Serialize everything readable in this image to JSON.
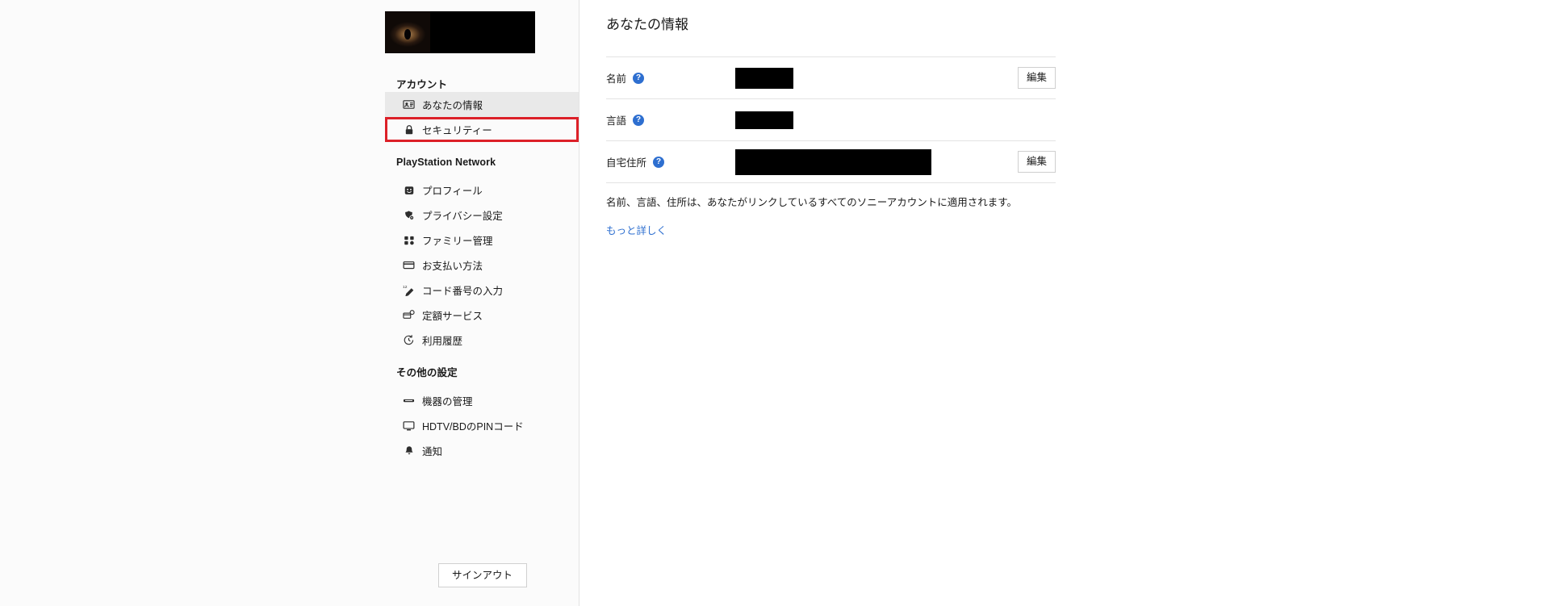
{
  "sidebar": {
    "account_avatar_alt": "user-avatar",
    "account_name_redacted": true,
    "sections": [
      {
        "heading": "アカウント",
        "items": [
          {
            "label": "あなたの情報",
            "icon": "contact-card-icon",
            "state": "selected"
          },
          {
            "label": "セキュリティー",
            "icon": "lock-icon",
            "state": "annotated"
          }
        ]
      },
      {
        "heading": "PlayStation Network",
        "items": [
          {
            "label": "プロフィール",
            "icon": "profile-face-icon",
            "state": "normal"
          },
          {
            "label": "プライバシー設定",
            "icon": "privacy-shield-icon",
            "state": "normal"
          },
          {
            "label": "ファミリー管理",
            "icon": "family-group-icon",
            "state": "normal"
          },
          {
            "label": "お支払い方法",
            "icon": "credit-card-icon",
            "state": "normal"
          },
          {
            "label": "コード番号の入力",
            "icon": "code-entry-icon",
            "state": "normal"
          },
          {
            "label": "定額サービス",
            "icon": "subscription-icon",
            "state": "normal"
          },
          {
            "label": "利用履歴",
            "icon": "history-clock-icon",
            "state": "normal"
          }
        ]
      },
      {
        "heading": "その他の設定",
        "items": [
          {
            "label": "機器の管理",
            "icon": "device-icon",
            "state": "normal"
          },
          {
            "label": "HDTV/BDのPINコード",
            "icon": "tv-monitor-icon",
            "state": "normal"
          },
          {
            "label": "通知",
            "icon": "bell-icon",
            "state": "normal"
          }
        ]
      }
    ],
    "signout_label": "サインアウト"
  },
  "main": {
    "title": "あなたの情報",
    "help_glyph": "?",
    "rows": [
      {
        "label": "名前",
        "value_redacted": true,
        "action_label": "編集",
        "has_action": true
      },
      {
        "label": "言語",
        "value_redacted": true,
        "action_label": "",
        "has_action": false
      },
      {
        "label": "自宅住所",
        "value_redacted": true,
        "action_label": "編集",
        "has_action": true
      }
    ],
    "note": "名前、言語、住所は、あなたがリンクしているすべてのソニーアカウントに適用されます。",
    "more_link": "もっと詳しく"
  },
  "colors": {
    "annotation_red": "#dc2028",
    "link_blue": "#2e6fd0",
    "help_blue": "#2e6fd0",
    "selected_bg": "#e9e9e9",
    "divider": "#e3e3e3"
  }
}
